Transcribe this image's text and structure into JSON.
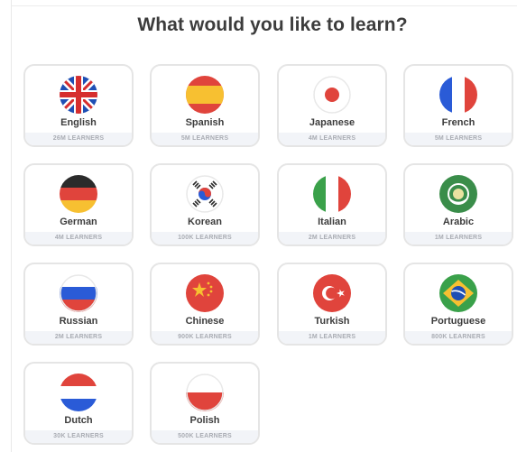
{
  "heading": "What would you like to learn?",
  "languages": [
    {
      "name": "English",
      "learners": "26M LEARNERS",
      "flag": "uk-flag-icon"
    },
    {
      "name": "Spanish",
      "learners": "5M LEARNERS",
      "flag": "spain-flag-icon"
    },
    {
      "name": "Japanese",
      "learners": "4M LEARNERS",
      "flag": "japan-flag-icon"
    },
    {
      "name": "French",
      "learners": "5M LEARNERS",
      "flag": "france-flag-icon"
    },
    {
      "name": "German",
      "learners": "4M LEARNERS",
      "flag": "germany-flag-icon"
    },
    {
      "name": "Korean",
      "learners": "100K LEARNERS",
      "flag": "korea-flag-icon"
    },
    {
      "name": "Italian",
      "learners": "2M LEARNERS",
      "flag": "italy-flag-icon"
    },
    {
      "name": "Arabic",
      "learners": "1M LEARNERS",
      "flag": "arab-league-flag-icon"
    },
    {
      "name": "Russian",
      "learners": "2M LEARNERS",
      "flag": "russia-flag-icon"
    },
    {
      "name": "Chinese",
      "learners": "900K LEARNERS",
      "flag": "china-flag-icon"
    },
    {
      "name": "Turkish",
      "learners": "1M LEARNERS",
      "flag": "turkey-flag-icon"
    },
    {
      "name": "Portuguese",
      "learners": "800K LEARNERS",
      "flag": "brazil-flag-icon"
    },
    {
      "name": "Dutch",
      "learners": "30K LEARNERS",
      "flag": "netherlands-flag-icon"
    },
    {
      "name": "Polish",
      "learners": "500K LEARNERS",
      "flag": "poland-flag-icon"
    }
  ],
  "colors": {
    "card_border": "#e5e5e5",
    "learners_bg": "#f2f4f8",
    "text": "#3c3c3c"
  }
}
